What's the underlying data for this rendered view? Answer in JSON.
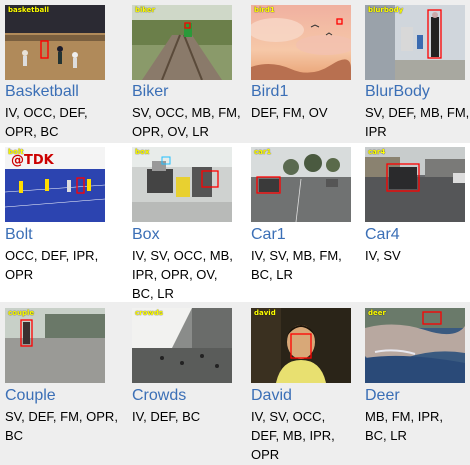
{
  "colors": {
    "link": "#3b6fb6",
    "band": "#eeeeee",
    "box": "#ff0000",
    "overlay_text": "#ffff00"
  },
  "sequences": [
    {
      "name": "Basketball",
      "overlay": "basketball",
      "attributes": "IV, OCC, DEF, OPR, BC"
    },
    {
      "name": "Biker",
      "overlay": "biker",
      "attributes": "SV, OCC, MB, FM, OPR, OV, LR"
    },
    {
      "name": "Bird1",
      "overlay": "bird1",
      "attributes": "DEF, FM, OV"
    },
    {
      "name": "BlurBody",
      "overlay": "blurbody",
      "attributes": "SV, DEF, MB, FM, IPR"
    },
    {
      "name": "Bolt",
      "overlay": "bolt",
      "attributes": "OCC, DEF, IPR, OPR"
    },
    {
      "name": "Box",
      "overlay": "box",
      "attributes": "IV, SV, OCC, MB, IPR, OPR, OV, BC, LR"
    },
    {
      "name": "Car1",
      "overlay": "car1",
      "attributes": "IV, SV, MB, FM, BC, LR"
    },
    {
      "name": "Car4",
      "overlay": "car4",
      "attributes": "IV, SV"
    },
    {
      "name": "Couple",
      "overlay": "couple",
      "attributes": "SV, DEF, FM, OPR, BC"
    },
    {
      "name": "Crowds",
      "overlay": "crowds",
      "attributes": "IV, DEF, BC"
    },
    {
      "name": "David",
      "overlay": "david",
      "attributes": "IV, SV, OCC, DEF, MB, IPR, OPR"
    },
    {
      "name": "Deer",
      "overlay": "deer",
      "attributes": "MB, FM, IPR, BC, LR"
    }
  ]
}
